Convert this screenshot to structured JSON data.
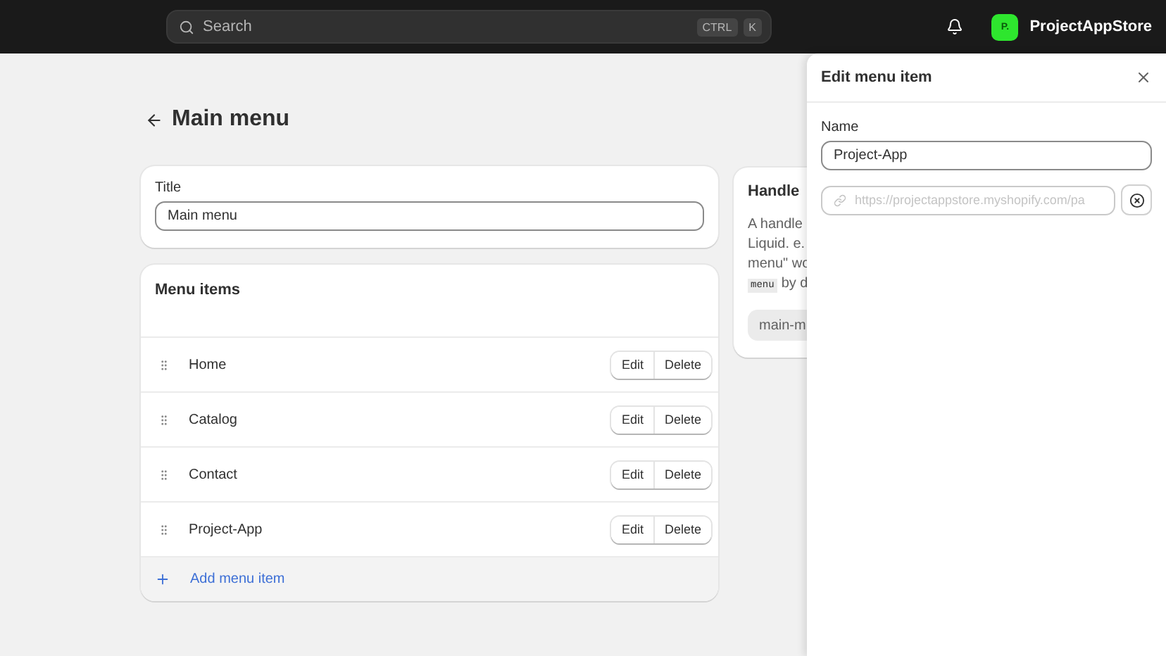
{
  "topbar": {
    "search": {
      "placeholder": "Search",
      "shortcut": [
        "CTRL",
        "K"
      ]
    },
    "store": {
      "initials": "P.",
      "name": "ProjectAppStore"
    }
  },
  "page": {
    "title": "Main menu"
  },
  "title_card": {
    "label": "Title",
    "value": "Main menu"
  },
  "menu_items": {
    "heading": "Menu items",
    "items": [
      {
        "label": "Home",
        "edit": "Edit",
        "delete": "Delete"
      },
      {
        "label": "Catalog",
        "edit": "Edit",
        "delete": "Delete"
      },
      {
        "label": "Contact",
        "edit": "Edit",
        "delete": "Delete"
      },
      {
        "label": "Project-App",
        "edit": "Edit",
        "delete": "Delete"
      }
    ],
    "add": "Add menu item"
  },
  "handle_card": {
    "heading": "Handle",
    "lines": [
      "A handle",
      "Liquid. e.",
      "menu\" wo"
    ],
    "code": "menu",
    "code_after": "by d",
    "value": "main-m"
  },
  "panel": {
    "title": "Edit menu item",
    "name_label": "Name",
    "name_value": "Project-App",
    "link_value": "https://projectappstore.myshopify.com/pa"
  }
}
